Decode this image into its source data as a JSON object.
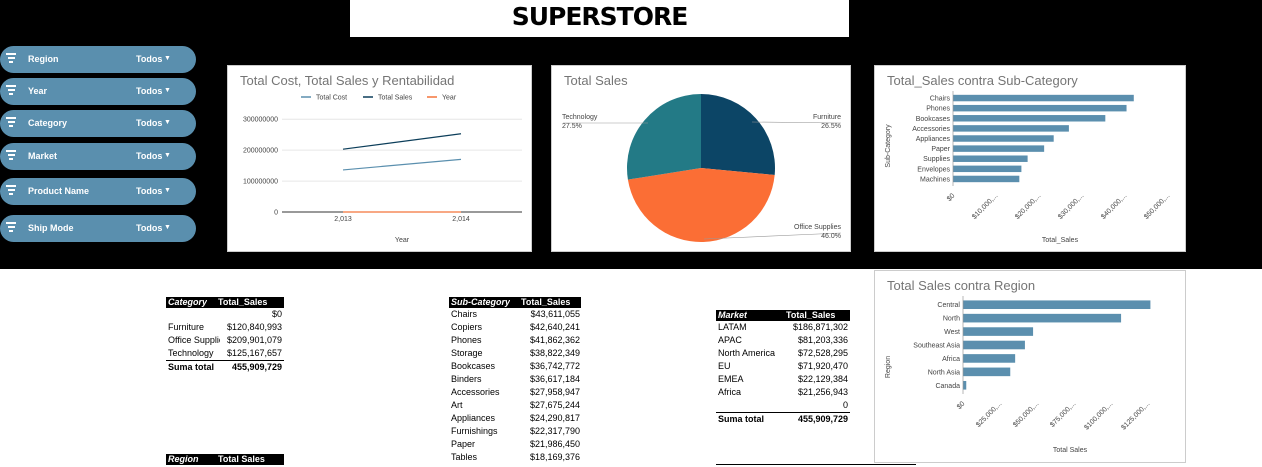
{
  "page": {
    "title": "SUPERSTORE"
  },
  "filters": [
    {
      "label": "Region",
      "value": "Todos"
    },
    {
      "label": "Year",
      "value": "Todos"
    },
    {
      "label": "Category",
      "value": "Todos"
    },
    {
      "label": "Market",
      "value": "Todos"
    },
    {
      "label": "Product Name",
      "value": "Todos"
    },
    {
      "label": "Ship Mode",
      "value": "Todos"
    }
  ],
  "colors": {
    "line_cost": "#5a8fae",
    "line_sales": "#0c3e5a",
    "line_year": "#f4743b",
    "pie_tech": "#237a86",
    "pie_furniture": "#0c4566",
    "pie_office": "#fb6e35",
    "bar": "#5b8fae"
  },
  "chart_data": [
    {
      "type": "line",
      "title": "Total Cost,  Total Sales y Rentabilidad",
      "xlabel": "Year",
      "categories": [
        "2,013",
        "2,014"
      ],
      "yticks": [
        "0",
        "100000000",
        "200000000",
        "300000000"
      ],
      "ylim": [
        0,
        320000000
      ],
      "series": [
        {
          "name": "Total Cost",
          "values": [
            136000000,
            170000000
          ]
        },
        {
          "name": "Total Sales",
          "values": [
            203000000,
            253000000
          ]
        },
        {
          "name": "Year",
          "values": [
            2013,
            2014
          ]
        }
      ],
      "legend": "top"
    },
    {
      "type": "pie",
      "title": "Total Sales",
      "slices": [
        {
          "label": "Furniture",
          "pct_label": "26.5%",
          "value": 26.5
        },
        {
          "label": "Office Supplies",
          "pct_label": "46.0%",
          "value": 46.0
        },
        {
          "label": "Technology",
          "pct_label": "27.5%",
          "value": 27.5
        }
      ]
    },
    {
      "type": "bar",
      "orientation": "horizontal",
      "title": "Total_Sales contra Sub-Category",
      "xlabel": "Total_Sales",
      "ylabel": "Sub-Category",
      "categories": [
        "Chairs",
        "Phones",
        "Bookcases",
        "Accessories",
        "Appliances",
        "Paper",
        "Supplies",
        "Envelopes",
        "Machines"
      ],
      "values": [
        43611055,
        41862362,
        36742772,
        27958947,
        24290817,
        21986450,
        18000000,
        16500000,
        16000000
      ],
      "ticks": [
        "$0",
        "$10,000,...",
        "$20,000,...",
        "$30,000,...",
        "$40,000,...",
        "$50,000,..."
      ],
      "xlim": [
        0,
        55000000
      ]
    },
    {
      "type": "bar",
      "orientation": "horizontal",
      "title": "Total Sales contra Region",
      "xlabel": "Total Sales",
      "ylabel": "Region",
      "categories": [
        "Central",
        "North",
        "West",
        "Southeast Asia",
        "Africa",
        "North Asia",
        "Canada"
      ],
      "values": [
        115000000,
        97000000,
        43000000,
        38000000,
        32000000,
        29000000,
        2000000
      ],
      "ticks": [
        "$0",
        "$25,000,...",
        "$50,000,...",
        "$75,000,...",
        "$100,000,...",
        "$125,000,..."
      ],
      "xlim": [
        0,
        135000000
      ]
    }
  ],
  "tables": {
    "category": {
      "headers": [
        "Category",
        "Total_Sales"
      ],
      "rows": [
        [
          "",
          "$0"
        ],
        [
          "Furniture",
          "$120,840,993"
        ],
        [
          "Office Supplies",
          "$209,901,079"
        ],
        [
          "Technology",
          "$125,167,657"
        ]
      ],
      "total": [
        "Suma total",
        "455,909,729"
      ]
    },
    "subcategory": {
      "headers": [
        "Sub-Category",
        "Total_Sales"
      ],
      "rows": [
        [
          "Chairs",
          "$43,611,055"
        ],
        [
          "Copiers",
          "$42,640,241"
        ],
        [
          "Phones",
          "$41,862,362"
        ],
        [
          "Storage",
          "$38,822,349"
        ],
        [
          "Bookcases",
          "$36,742,772"
        ],
        [
          "Binders",
          "$36,617,184"
        ],
        [
          "Accessories",
          "$27,958,947"
        ],
        [
          "Art",
          "$27,675,244"
        ],
        [
          "Appliances",
          "$24,290,817"
        ],
        [
          "Furnishings",
          "$22,317,790"
        ],
        [
          "Paper",
          "$21,986,450"
        ],
        [
          "Tables",
          "$18,169,376"
        ]
      ]
    },
    "market": {
      "headers": [
        "Market",
        "Total_Sales"
      ],
      "rows": [
        [
          "LATAM",
          "$186,871,302"
        ],
        [
          "APAC",
          "$81,203,336"
        ],
        [
          "North America",
          "$72,528,295"
        ],
        [
          "EU",
          "$71,920,470"
        ],
        [
          "EMEA",
          "$22,129,384"
        ],
        [
          "Africa",
          "$21,256,943"
        ],
        [
          "",
          "0"
        ]
      ],
      "total": [
        "Suma total",
        "455,909,729"
      ]
    },
    "region": {
      "headers": [
        "Region",
        "Total Sales"
      ]
    }
  }
}
